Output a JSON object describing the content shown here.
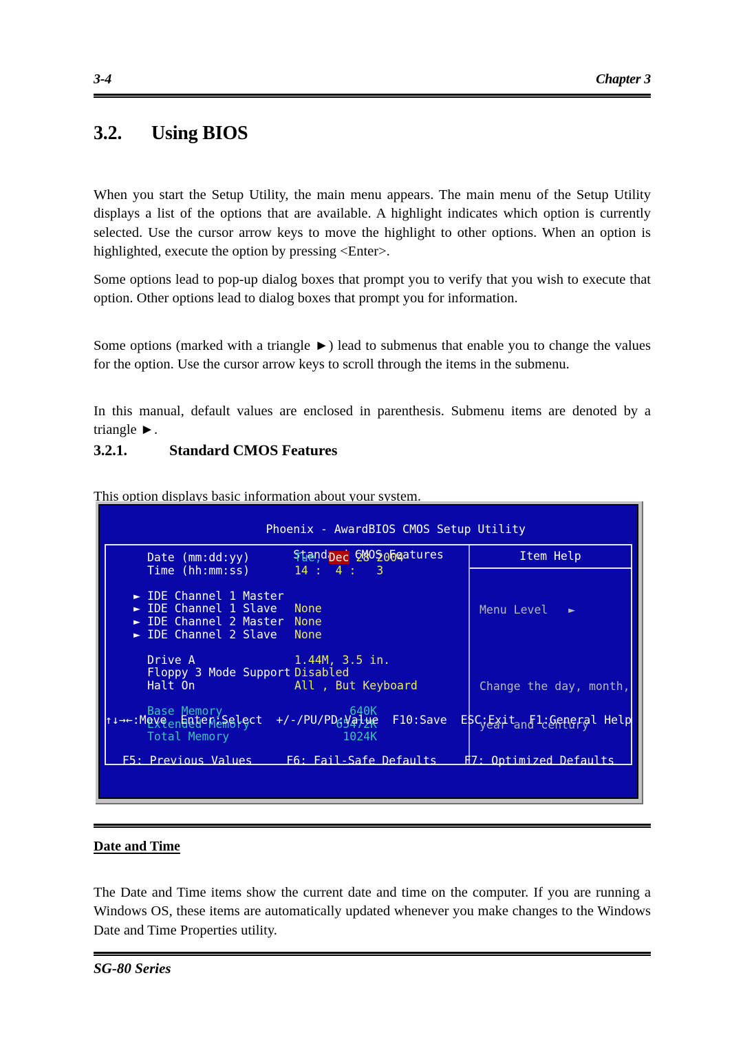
{
  "header": {
    "page_number": "3-4",
    "chapter": "Chapter 3"
  },
  "section": {
    "number": "3.2.",
    "title": "Using BIOS"
  },
  "paragraphs": {
    "p1": "When you start the Setup Utility, the main menu appears. The main menu of the Setup Utility displays a list of the options that are available. A highlight indicates which option is currently selected. Use the cursor arrow keys to move the highlight to other options. When an option is highlighted, execute the option by pressing <Enter>.",
    "p2": "Some options lead to pop-up dialog boxes that prompt you to verify that you wish to execute that option. Other options lead to dialog boxes that prompt you for information.",
    "p3": "Some options (marked with a triangle ►) lead to submenus that enable you to change the values for the option. Use the cursor arrow keys to scroll through the items in the submenu.",
    "p4": "In this manual, default values are enclosed in parenthesis. Submenu items are denoted by a triangle ►.",
    "p5": "This option displays basic information about your system.",
    "p6": "The Date and Time items show the current date and time on the computer. If you are running a Windows OS, these items are automatically updated whenever you make changes to the Windows Date and Time Properties utility."
  },
  "subsection": {
    "number": "3.2.1.",
    "title": "Standard CMOS Features"
  },
  "subheading": {
    "date_and_time": "Date and Time"
  },
  "bios": {
    "title_line1": "Phoenix - AwardBIOS CMOS Setup Utility",
    "title_line2": "Standard CMOS Features",
    "marker_triangle": "►",
    "rows": {
      "date_label": "Date (mm:dd:yy)",
      "date_weekday": "Tue,",
      "date_month": "Dec",
      "date_rest": " 28 2004",
      "time_label": "Time (hh:mm:ss)",
      "time_value": "14 :  4 :   3",
      "ide1m_label": "IDE Channel 1 Master",
      "ide1m_value": "",
      "ide1s_label": "IDE Channel 1 Slave",
      "ide1s_value": "None",
      "ide2m_label": "IDE Channel 2 Master",
      "ide2m_value": "None",
      "ide2s_label": "IDE Channel 2 Slave",
      "ide2s_value": "None",
      "drivea_label": "Drive A",
      "drivea_value": "1.44M, 3.5 in.",
      "floppy3_label": "Floppy 3 Mode Support",
      "floppy3_value": "Disabled",
      "halton_label": "Halt On",
      "halton_value": "All , But Keyboard",
      "base_memory_label": "Base Memory",
      "base_memory_value": "640K",
      "extended_memory_label": "Extended Memory",
      "extended_memory_value": "65472K",
      "total_memory_label": "Total Memory",
      "total_memory_value": "1024K"
    },
    "help": {
      "title": "Item Help",
      "menu_level": "Menu Level   ►",
      "description_line1": "Change the day, month,",
      "description_line2": "year and century"
    },
    "legend": {
      "line1": "↑↓→←:Move  Enter:Select  +/-/PU/PD:Value  F10:Save  ESC:Exit  F1:General Help",
      "line2": "F5: Previous Values     F6: Fail-Safe Defaults    F7: Optimized Defaults"
    },
    "colors": {
      "background": "#0808a8",
      "value_yellow": "#eded5a",
      "memory_teal": "#3fc3b5",
      "highlight_red": "#b00000",
      "chrome_grey": "#c3c3c3"
    }
  },
  "footer": {
    "product": "SG-80 Series"
  }
}
